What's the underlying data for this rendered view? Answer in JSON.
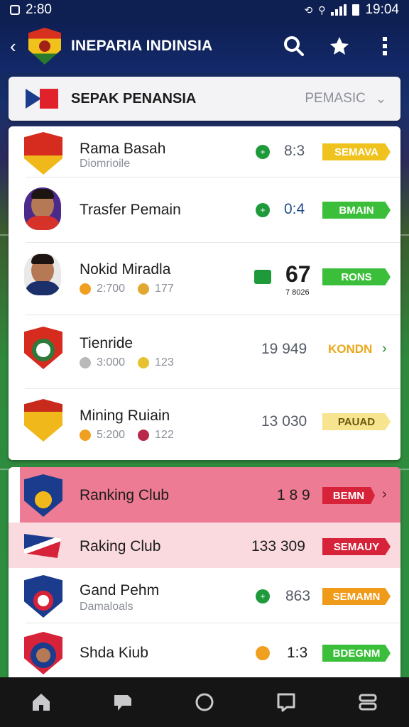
{
  "status": {
    "time_left": "2:80",
    "time_right": "19:04"
  },
  "header": {
    "title": "INEPARIA INDINSIA"
  },
  "filter": {
    "title": "SEPAK PENANSIA",
    "selected": "PEMASIC"
  },
  "rows": [
    {
      "name": "Rama Basah",
      "sub": "Diomrioile",
      "score": "8:3",
      "badge": "SEMAVA",
      "badge_color": "#efc21d"
    },
    {
      "name": "Trasfer Pemain",
      "score": "0:4",
      "badge": "BMAIN",
      "badge_color": "#3bbf3a"
    },
    {
      "name": "Nokid Miradla",
      "stat1": "2:700",
      "stat2": "177",
      "score_big": "67",
      "score_sub": "7 8026",
      "badge": "RONS",
      "badge_color": "#3bbf3a"
    },
    {
      "name": "Tienride",
      "stat1": "3:000",
      "stat2": "123",
      "score": "19 949",
      "badge": "KONDN"
    },
    {
      "name": "Mining Ruiain",
      "stat1": "5:200",
      "stat2": "122",
      "score": "13 030",
      "badge": "PAUAD",
      "badge_color": "#f6e58e"
    },
    {
      "name": "Ranking Club",
      "score": "1 8 9",
      "badge": "BEMN",
      "badge_color": "#d7233a"
    },
    {
      "name": "Raking Club",
      "score": "133 309",
      "badge": "SEMAUY",
      "badge_color": "#d7233a"
    },
    {
      "name": "Gand Pehm",
      "sub": "Damaloals",
      "score": "863",
      "badge": "SEMAMN",
      "badge_color": "#f09a1a"
    },
    {
      "name": "Shda Kiub",
      "score": "1:3",
      "badge": "BDEGNM",
      "badge_color": "#3bbf3a"
    }
  ]
}
